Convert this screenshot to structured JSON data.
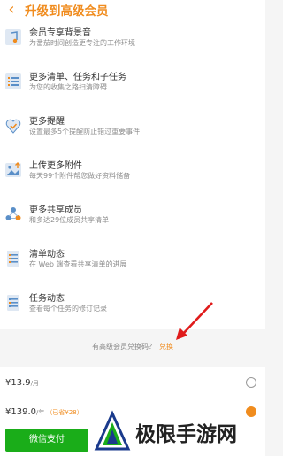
{
  "header": {
    "back_icon": "chevron-left-icon",
    "title": "升级到高级会员"
  },
  "features": [
    {
      "icon": "music-note-icon",
      "title": "会员专享背景音",
      "desc": "为番茄时间创造更专注的工作环境"
    },
    {
      "icon": "list-icon",
      "title": "更多清单、任务和子任务",
      "desc": "为您的收集之路扫清障碍"
    },
    {
      "icon": "heart-alarm-icon",
      "title": "更多提醒",
      "desc": "设置最多5个提醒防止错过重要事件"
    },
    {
      "icon": "upload-attachment-icon",
      "title": "上传更多附件",
      "desc": "每天99个附件帮您做好资料储备"
    },
    {
      "icon": "share-member-icon",
      "title": "更多共享成员",
      "desc": "和多达29位成员共享清单"
    },
    {
      "icon": "list-activity-icon",
      "title": "清单动态",
      "desc": "在 Web 端查看共享清单的进展"
    },
    {
      "icon": "task-activity-icon",
      "title": "任务动态",
      "desc": "查看每个任务的修订记录"
    }
  ],
  "redeem": {
    "text": "有高级会员兑换码？",
    "link": "兑换"
  },
  "plans": [
    {
      "price": "¥13.9",
      "unit": "/月",
      "badge": "",
      "selected": false
    },
    {
      "price": "¥139.0",
      "unit": "/年",
      "badge": "（已省¥28）",
      "selected": true
    }
  ],
  "pay_button": "微信支付",
  "watermark": {
    "text": "极限手游网"
  },
  "colors": {
    "accent": "#f08c1e",
    "wechat_green": "#1aad19",
    "icon_blue": "#5a8fc8",
    "arrow_red": "#e01b1b"
  }
}
